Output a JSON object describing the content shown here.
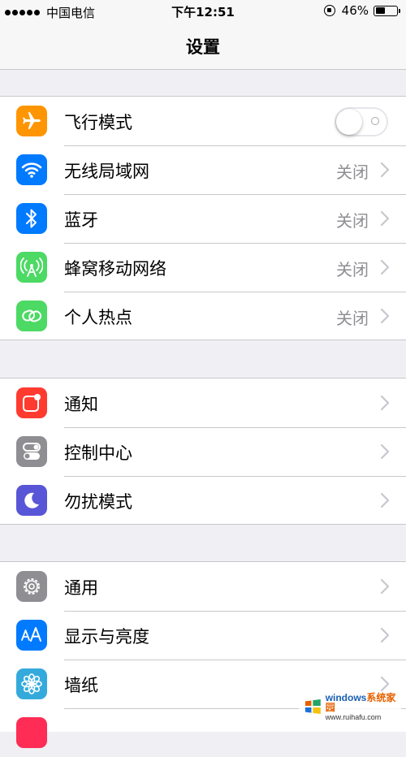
{
  "status_bar": {
    "carrier": "中国电信",
    "time": "下午12:51",
    "battery_percent": "46%",
    "battery_level": 0.46
  },
  "nav": {
    "title": "设置"
  },
  "groups": [
    {
      "rows": [
        {
          "label": "飞行模式",
          "icon": "airplane-icon",
          "icon_color": "#ff9500",
          "control": "toggle",
          "toggle_on": false
        },
        {
          "label": "无线局域网",
          "icon": "wifi-icon",
          "icon_color": "#007aff",
          "value": "关闭"
        },
        {
          "label": "蓝牙",
          "icon": "bluetooth-icon",
          "icon_color": "#007aff",
          "value": "关闭"
        },
        {
          "label": "蜂窝移动网络",
          "icon": "cellular-icon",
          "icon_color": "#4cd964",
          "value": "关闭"
        },
        {
          "label": "个人热点",
          "icon": "hotspot-icon",
          "icon_color": "#4cd964",
          "value": "关闭"
        }
      ]
    },
    {
      "rows": [
        {
          "label": "通知",
          "icon": "notifications-icon",
          "icon_color": "#ff3b30"
        },
        {
          "label": "控制中心",
          "icon": "control-center-icon",
          "icon_color": "#8e8e93"
        },
        {
          "label": "勿扰模式",
          "icon": "moon-icon",
          "icon_color": "#5856d6"
        }
      ]
    },
    {
      "rows": [
        {
          "label": "通用",
          "icon": "gear-icon",
          "icon_color": "#8e8e93"
        },
        {
          "label": "显示与亮度",
          "icon": "display-brightness-icon",
          "icon_color": "#007aff"
        },
        {
          "label": "墙纸",
          "icon": "wallpaper-flower-icon",
          "icon_color": "#34aadc"
        }
      ]
    }
  ],
  "watermark": {
    "brand_blue": "windows",
    "brand_orange": "系统家园",
    "url": "www.ruihafu.com"
  }
}
